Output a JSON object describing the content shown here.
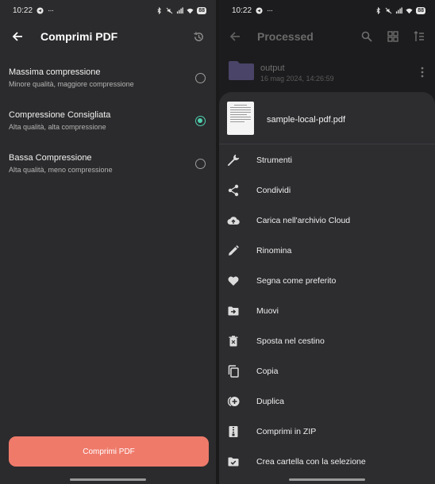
{
  "left": {
    "status": {
      "time": "10:22",
      "battery": "88"
    },
    "title": "Comprimi PDF",
    "options": [
      {
        "title": "Massima compressione",
        "subtitle": "Minore qualità, maggiore compressione",
        "selected": false
      },
      {
        "title": "Compressione Consigliata",
        "subtitle": "Alta qualità, alta compressione",
        "selected": true
      },
      {
        "title": "Bassa Compressione",
        "subtitle": "Alta qualità, meno compressione",
        "selected": false
      }
    ],
    "button_label": "Comprimi PDF"
  },
  "right": {
    "status": {
      "time": "10:22",
      "battery": "88"
    },
    "title": "Processed",
    "folder": {
      "name": "output",
      "date": "16 mag 2024, 14:26:59"
    },
    "sheet": {
      "file_name": "sample-local-pdf.pdf",
      "items": [
        {
          "label": "Strumenti",
          "icon": "wrench-icon"
        },
        {
          "label": "Condividi",
          "icon": "share-icon"
        },
        {
          "label": "Carica nell'archivio Cloud",
          "icon": "cloud-upload-icon"
        },
        {
          "label": "Rinomina",
          "icon": "pencil-icon"
        },
        {
          "label": "Segna come preferito",
          "icon": "heart-icon"
        },
        {
          "label": "Muovi",
          "icon": "move-folder-icon"
        },
        {
          "label": "Sposta nel cestino",
          "icon": "trash-icon"
        },
        {
          "label": "Copia",
          "icon": "copy-icon"
        },
        {
          "label": "Duplica",
          "icon": "duplicate-icon"
        },
        {
          "label": "Comprimi in ZIP",
          "icon": "zip-icon"
        },
        {
          "label": "Crea cartella con la selezione",
          "icon": "create-folder-icon"
        }
      ]
    }
  },
  "colors": {
    "accent": "#ef7a6a",
    "radio_selected": "#4fd1b0",
    "folder": "#4a4468"
  }
}
